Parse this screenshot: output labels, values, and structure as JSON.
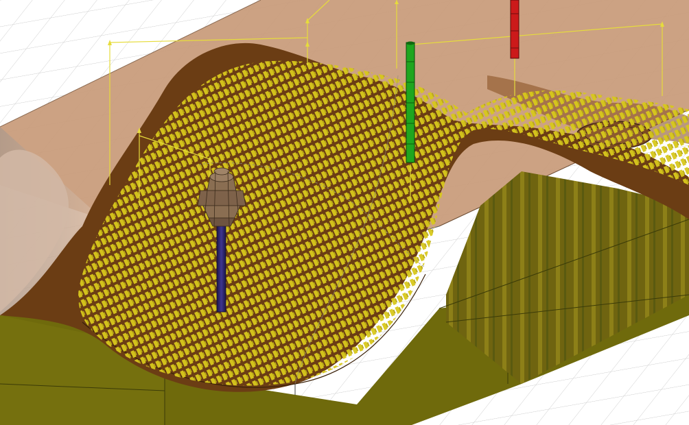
{
  "viewport": {
    "view": "3d-cam-toolpath-simulation",
    "background_color": "#ffffff",
    "grid_color": "#c8c8c8"
  },
  "stock": {
    "top_color": "#c89a78",
    "side_color": "#cfa586",
    "part_surface_color": "#6b3d14",
    "machined_wall_color": "#7a6c10",
    "base_color": "#6f6a0c"
  },
  "toolpath": {
    "color": "#d8c81c",
    "link_line_color": "#e6dc3c"
  },
  "tool": {
    "shank_color": "#2c2466",
    "holder_color": "#8a6e52"
  },
  "markers": [
    {
      "name": "start-marker",
      "color": "#1fa61f"
    },
    {
      "name": "end-marker",
      "color": "#cc1a1a"
    }
  ]
}
